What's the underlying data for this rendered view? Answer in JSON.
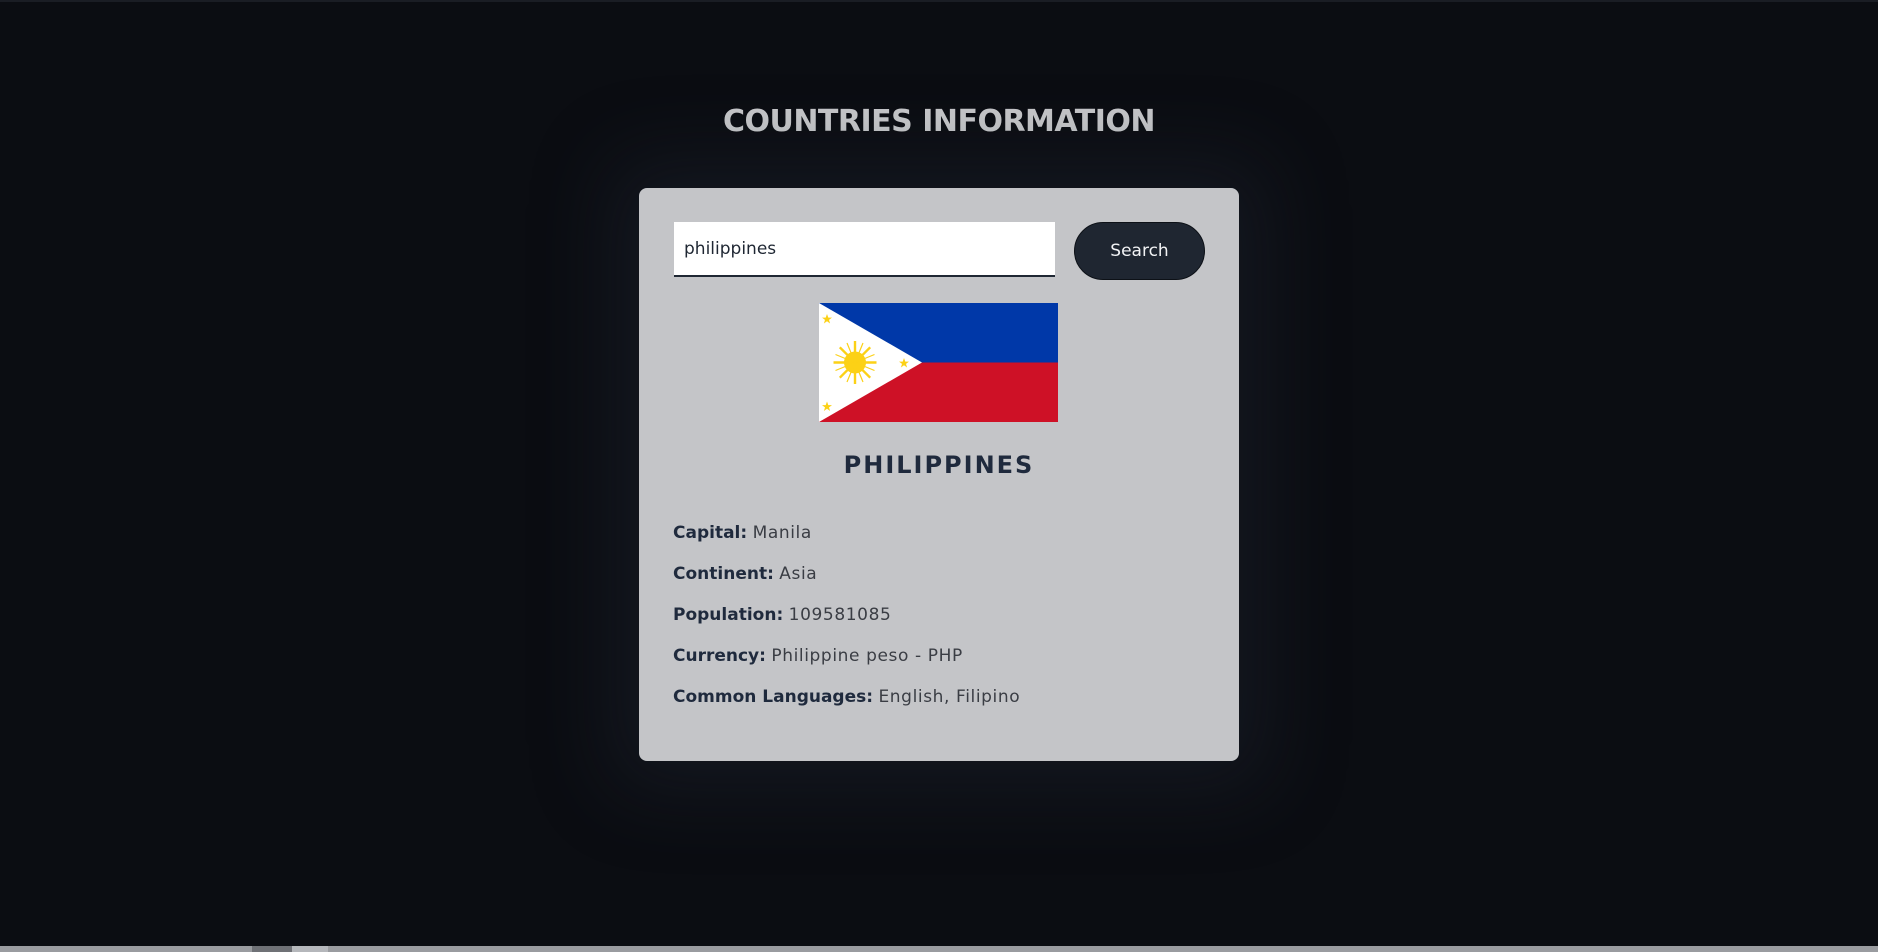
{
  "page": {
    "title": "COUNTRIES INFORMATION"
  },
  "search": {
    "value": "philippines",
    "placeholder": "",
    "button_label": "Search"
  },
  "country": {
    "name": "PHILIPPINES",
    "flag_icon": "philippines-flag-icon",
    "details": [
      {
        "label": "Capital:",
        "value": "Manila"
      },
      {
        "label": "Continent:",
        "value": "Asia"
      },
      {
        "label": "Population:",
        "value": "109581085"
      },
      {
        "label": "Currency:",
        "value": "Philippine peso - PHP"
      },
      {
        "label": "Common Languages:",
        "value": "English, Filipino"
      }
    ]
  },
  "colors": {
    "background": "#0b0d12",
    "card": "#c4c5c8",
    "title": "#c8c9cb",
    "accent_dark": "#1f2631",
    "flag_blue": "#0038a8",
    "flag_red": "#ce1126",
    "flag_white": "#ffffff",
    "flag_yellow": "#fcd116"
  }
}
